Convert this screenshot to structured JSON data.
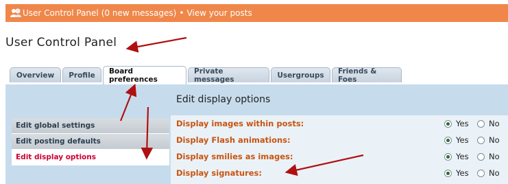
{
  "topbar": {
    "link_text": "User Control Panel",
    "message_count": "(0 new messages)",
    "separator": "•",
    "view_posts": "View your posts"
  },
  "page_title": "User Control Panel",
  "tabs": [
    {
      "label": "Overview"
    },
    {
      "label": "Profile"
    },
    {
      "label": "Board preferences",
      "active": true
    },
    {
      "label": "Private messages"
    },
    {
      "label": "Usergroups"
    },
    {
      "label": "Friends & Foes"
    }
  ],
  "panel_title": "Edit display options",
  "sidebar": [
    {
      "label": "Edit global settings"
    },
    {
      "label": "Edit posting defaults"
    },
    {
      "label": "Edit display options",
      "active": true
    }
  ],
  "options": [
    {
      "label": "Display images within posts:",
      "yes": "Yes",
      "no": "No",
      "selected": "Yes"
    },
    {
      "label": "Display Flash animations:",
      "yes": "Yes",
      "no": "No",
      "selected": "Yes"
    },
    {
      "label": "Display smilies as images:",
      "yes": "Yes",
      "no": "No",
      "selected": "Yes"
    },
    {
      "label": "Display signatures:",
      "yes": "Yes",
      "no": "No",
      "selected": "Yes"
    }
  ],
  "colors": {
    "topbar": "#f0874a",
    "option_label": "#c8540f",
    "active_side": "#cc0033",
    "arrow": "#b01010"
  }
}
